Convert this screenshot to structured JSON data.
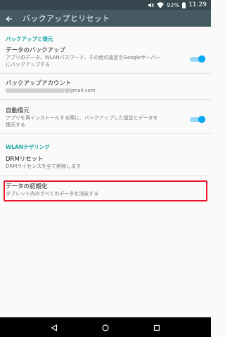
{
  "status_bar": {
    "battery": "92%",
    "time": "11:29",
    "icons": [
      "mute-icon",
      "wifi-icon",
      "battery-icon"
    ]
  },
  "app_bar": {
    "back_icon": "arrow-back-icon",
    "title": "バックアップとリセット"
  },
  "sections": {
    "backup_restore": {
      "header": "バックアップと復元",
      "data_backup": {
        "title": "データのバックアップ",
        "summary_line1": "アプリのデータ、WLANパスワード、その他の設定をGoogleサーバー",
        "summary_line2": "にバックアップする",
        "toggle_on": true
      },
      "backup_account": {
        "title": "バックアップアカウント",
        "summary": "@gmail.com"
      },
      "auto_restore": {
        "title": "自動復元",
        "summary_line1": "アプリを再インストールする際に、バックアップした設定とデータを",
        "summary_line2": "復元する",
        "toggle_on": true
      }
    },
    "wlan_tethering": {
      "header": "WLANテザリング",
      "drm_reset": {
        "title": "DRMリセット",
        "summary": "DRMライセンスを全て削除します"
      },
      "factory_reset": {
        "title": "データの初期化",
        "summary": "タブレット内のすべてのデータを消去する"
      }
    }
  },
  "nav_bar": {
    "icons": [
      "back-triangle-icon",
      "home-circle-icon",
      "recents-square-icon"
    ]
  },
  "colors": {
    "accent": "#1aa3a3",
    "toolbar": "#455a64",
    "status_bar": "#37474f",
    "toggle": "#03a9f4",
    "highlight": "#e8182f"
  }
}
